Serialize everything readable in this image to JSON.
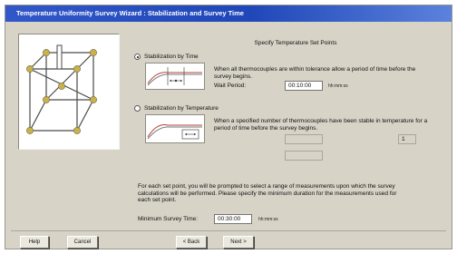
{
  "window": {
    "title": "Temperature Uniformity Survey Wizard : Stabilization and Survey Time"
  },
  "main": {
    "heading": "Specify Temperature Set Points",
    "option_time": {
      "label": "Stabilization by Time",
      "selected": true,
      "description": "When all thermocouples are within tolerance allow a period of time before the survey begins.",
      "wait_label": "Wait Period:",
      "wait_value": "00:10:00",
      "wait_unit": "hh:mm:ss"
    },
    "option_temp": {
      "label": "Stabilization by Temperature",
      "selected": false,
      "description": "When a specified number of thermocouples have been stable in temperature for a period of time before the survey begins.",
      "count_value": "1"
    },
    "survey_note": "For each set point, you will be prompted to select a range of measurements upon which the survey calculations will be performed. Please specify the minimum duration for the measurements used for each set point.",
    "min_time_label": "Minimum Survey Time:",
    "min_time_value": "00:30:00",
    "min_time_unit": "hh:mm:ss"
  },
  "buttons": {
    "help": "Help",
    "cancel": "Cancel",
    "back": "< Back",
    "next": "Next >"
  },
  "colors": {
    "title_bar": "#2a52c2",
    "dialog_bg": "#d7d3c7",
    "cube_line": "#4a4a4a",
    "node_fill": "#c9b24e"
  }
}
